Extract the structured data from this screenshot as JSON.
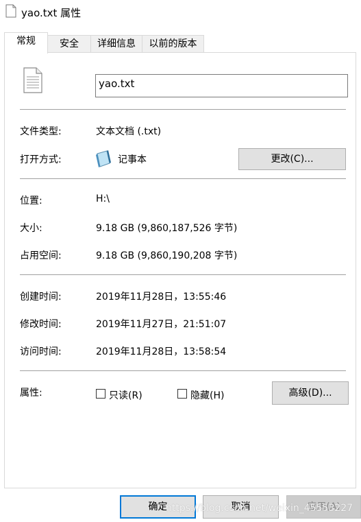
{
  "window": {
    "title": "yao.txt 属性"
  },
  "tabs": [
    {
      "label": "常规"
    },
    {
      "label": "安全"
    },
    {
      "label": "详细信息"
    },
    {
      "label": "以前的版本"
    }
  ],
  "general": {
    "filename": "yao.txt",
    "file_type_label": "文件类型:",
    "file_type_value": "文本文档 (.txt)",
    "open_with_label": "打开方式:",
    "open_with_app": "记事本",
    "change_button": "更改(C)...",
    "location_label": "位置:",
    "location_value": "H:\\",
    "size_label": "大小:",
    "size_value": "9.18 GB (9,860,187,526 字节)",
    "size_on_disk_label": "占用空间:",
    "size_on_disk_value": "9.18 GB (9,860,190,208 字节)",
    "created_label": "创建时间:",
    "created_value": "2019年11月28日，13:55:46",
    "modified_label": "修改时间:",
    "modified_value": "2019年11月27日，21:51:07",
    "accessed_label": "访问时间:",
    "accessed_value": "2019年11月28日，13:58:54",
    "attributes_label": "属性:",
    "readonly_label": "只读(R)",
    "hidden_label": "隐藏(H)",
    "advanced_button": "高级(D)..."
  },
  "footer": {
    "ok": "确定",
    "cancel": "取消",
    "apply": "应用(A)"
  },
  "watermark": "https://blog.csdn.net/weixin_45553227",
  "icons": {
    "title": "text-file-icon",
    "file": "text-document-icon",
    "app": "notepad-icon"
  },
  "colors": {
    "accent": "#0078d7",
    "separator": "#a0a0a0",
    "button": "#e1e1e1"
  }
}
